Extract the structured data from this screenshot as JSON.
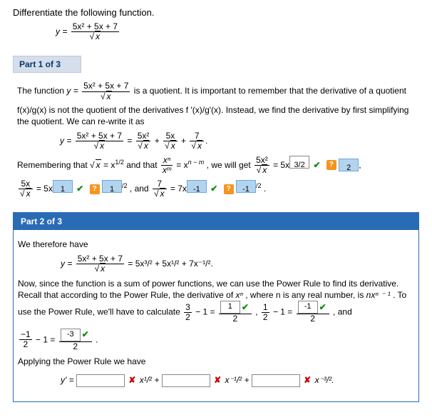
{
  "intro": {
    "prompt": "Differentiate the following function.",
    "lhs": "y =",
    "num": "5x² + 5x + 7",
    "den_rad": "x"
  },
  "part1": {
    "header": "Part 1 of 3",
    "line1_a": "The function ",
    "line1_func": "y = ",
    "line1_num": "5x² + 5x + 7",
    "line1_den_rad": "x",
    "line1_b": " is a quotient. It is important to remember that the derivative of a quotient",
    "line2": "f(x)/g(x)  is not the quotient of the derivatives  f '(x)/g'(x).  Instead, we find the derivative by first simplifying the quotient. We can re-write it as",
    "rw_lhs": "y = ",
    "rw_num": "5x² + 5x + 7",
    "rw_den_rad": "x",
    "rw_eq": " = ",
    "t1_num": "5x²",
    "t1_den_rad": "x",
    "t2_num": "5x",
    "t2_den_rad": "x",
    "t3_num": "7",
    "t3_den_rad": "x",
    "remember_a": "Remembering that ",
    "remember_sqrt": "x",
    "remember_eq": " = x",
    "remember_exp": "1/2",
    "remember_b": " and that ",
    "pm_num": "xⁿ",
    "pm_den": "xᵐ",
    "pm_eq": " = x",
    "pm_exp": "n − m",
    "remember_c": ", we will get ",
    "g1_num": "5x²",
    "g1_den_rad": "x",
    "g1_eq": " = 5x",
    "ans1": "3/2",
    "help": "?",
    "blue1": "2",
    "g2_num": "5x",
    "g2_den_rad": "x",
    "g2_eq": " = 5x",
    "ans2": "1",
    "g2_exp": "/2",
    "g3_a": ",  and  ",
    "g3_num": "7",
    "g3_den_rad": "x",
    "g3_eq": " = 7x",
    "ans3": "-1",
    "g3_exp": "/2",
    "period": "."
  },
  "part2": {
    "header": "Part 2 of 3",
    "line1": "We therefore have",
    "res_lhs": "y = ",
    "res_num": "5x² + 5x + 7",
    "res_den_rad": "x",
    "res_rhs": " = 5x³/² + 5x¹/² + 7x⁻¹/².",
    "exp1": "Now, since the function is a sum of power functions, we can use the Power Rule to find its derivative. Recall that according to the Power Rule, the derivative of ",
    "xn": "xⁿ",
    "exp2": ", where n is any real number, is ",
    "nx": "nxⁿ ⁻ ¹",
    "exp3": ". To use the Power Rule, we'll have to calculate ",
    "c1_frac_num": "3",
    "c1_frac_den": "2",
    "c1_m1": " − 1 = ",
    "c1_ans_num": "1",
    "c1_ans_den": "2",
    "sep1": ",   ",
    "c2_frac_num": "1",
    "c2_frac_den": "2",
    "c2_m1": " − 1 = ",
    "c2_ans_num": "-1",
    "c2_ans_den": "2",
    "sep2": ",  and",
    "c3_frac_num": "−1",
    "c3_frac_den": "2",
    "c3_m1": " − 1 = ",
    "c3_ans_num": "-3",
    "c3_ans_den": "2",
    "c3_end": ".",
    "apply": "Applying the Power Rule we have",
    "yprime": "y' = ",
    "r1": " x¹/² + ",
    "r2": " x⁻¹/² + ",
    "r3": " x⁻³/²."
  },
  "icons": {
    "check": "✔",
    "cross": "✘"
  }
}
